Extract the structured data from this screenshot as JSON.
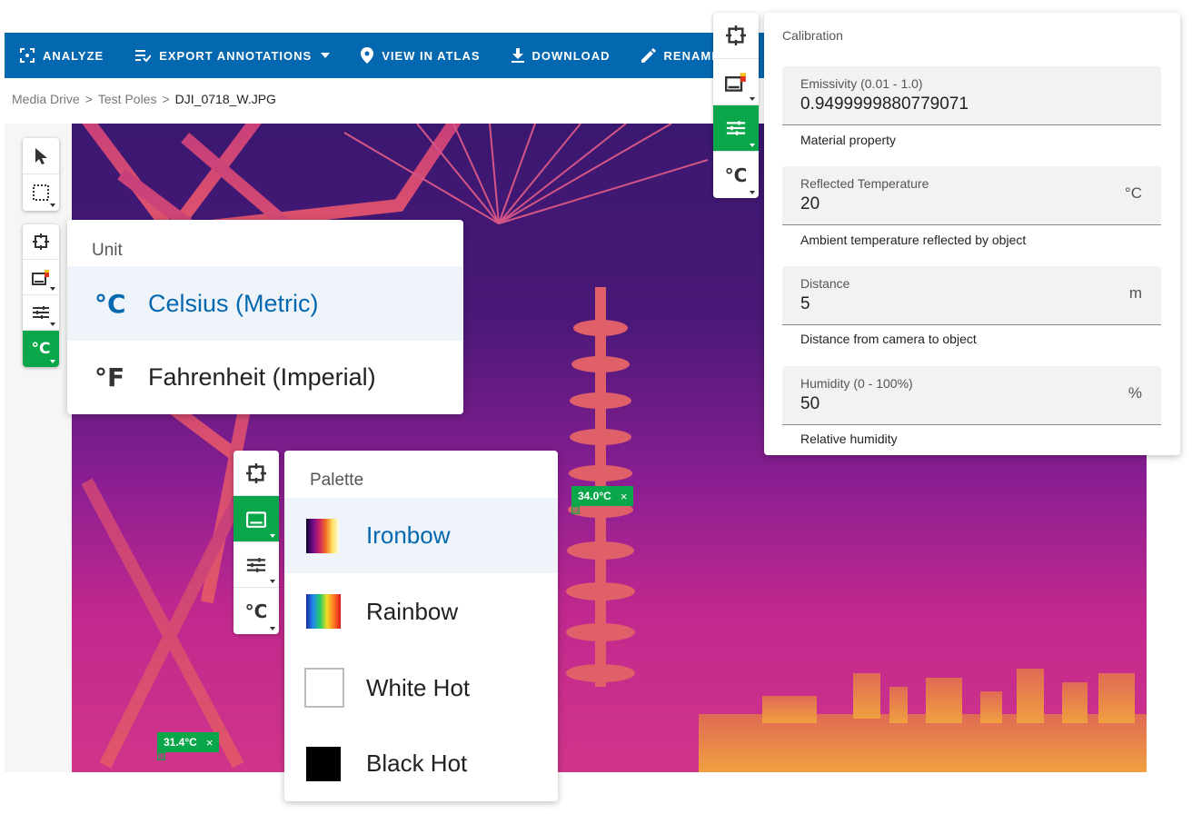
{
  "toolbar": {
    "analyze": "ANALYZE",
    "export_annotations": "EXPORT ANNOTATIONS",
    "view_in_atlas": "VIEW IN ATLAS",
    "download": "DOWNLOAD",
    "rename": "RENAME",
    "icons": [
      "analyze-icon",
      "export-list-icon",
      "map-pin-icon",
      "download-icon",
      "pencil-icon"
    ],
    "background_color": "#0468b0"
  },
  "breadcrumb": {
    "items": [
      "Media Drive",
      "Test Poles",
      "DJI_0718_W.JPG"
    ],
    "separator": ">"
  },
  "unit_menu": {
    "title": "Unit",
    "options": [
      {
        "symbol": "°C",
        "label": "Celsius (Metric)",
        "selected": true
      },
      {
        "symbol": "°F",
        "label": "Fahrenheit (Imperial)",
        "selected": false
      }
    ]
  },
  "palette_menu": {
    "title": "Palette",
    "options": [
      {
        "label": "Ironbow",
        "selected": true
      },
      {
        "label": "Rainbow",
        "selected": false
      },
      {
        "label": "White Hot",
        "selected": false
      },
      {
        "label": "Black Hot",
        "selected": false
      }
    ]
  },
  "tool_groups": {
    "unit_button": "°C",
    "selected_color": "#0aa64a"
  },
  "temperature_labels": [
    {
      "value": "34.0°C",
      "close": "×"
    },
    {
      "value": "31.4°C",
      "close": "×"
    }
  ],
  "calibration": {
    "title": "Calibration",
    "fields": [
      {
        "label": "Emissivity (0.01 - 1.0)",
        "value": "0.9499999880779071",
        "unit": "",
        "helper": "Material property"
      },
      {
        "label": "Reflected Temperature",
        "value": "20",
        "unit": "°C",
        "helper": "Ambient temperature reflected by object"
      },
      {
        "label": "Distance",
        "value": "5",
        "unit": "m",
        "helper": "Distance from camera to object"
      },
      {
        "label": "Humidity (0 - 100%)",
        "value": "50",
        "unit": "%",
        "helper": "Relative humidity"
      }
    ]
  },
  "colors": {
    "accent_blue": "#0468b0",
    "active_green": "#0aa64a",
    "selected_row": "#eef4fa"
  }
}
